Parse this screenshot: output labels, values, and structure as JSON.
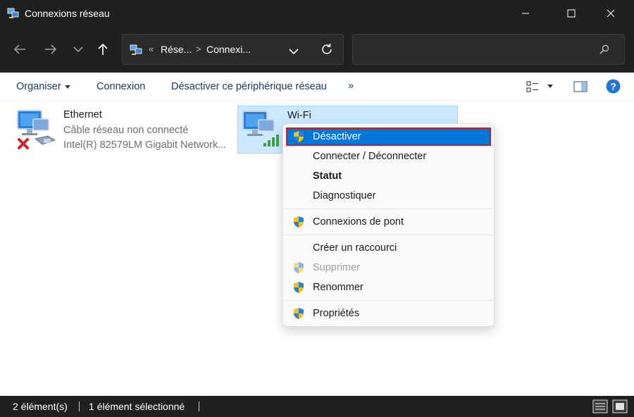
{
  "window": {
    "title": "Connexions réseau",
    "controls": {
      "minimize": "minimize-icon",
      "maximize": "maximize-icon",
      "close": "close-icon"
    }
  },
  "address": {
    "overflow": "«",
    "parts": [
      "Rése...",
      "Connexi..."
    ],
    "separator": ">",
    "search_placeholder": ""
  },
  "toolbar": {
    "organize": "Organiser",
    "connect": "Connexion",
    "disable_device": "Désactiver ce périphérique réseau",
    "more": "»"
  },
  "items": [
    {
      "name": "Ethernet",
      "status": "Câble réseau non connecté",
      "device": "Intel(R) 82579LM Gigabit Network..."
    },
    {
      "name": "Wi-Fi"
    }
  ],
  "context_menu": {
    "items": [
      {
        "label": "Désactiver",
        "shield": true,
        "selected": true
      },
      {
        "label": "Connecter / Déconnecter"
      },
      {
        "label": "Statut",
        "bold": true
      },
      {
        "label": "Diagnostiquer"
      },
      {
        "label": "Connexions de pont",
        "shield": true
      },
      {
        "label": "Créer un raccourci"
      },
      {
        "label": "Supprimer",
        "shield": true,
        "disabled": true
      },
      {
        "label": "Renommer",
        "shield": true
      },
      {
        "label": "Propriétés",
        "shield": true
      }
    ]
  },
  "status": {
    "count": "2 élément(s)",
    "selected": "1 élément sélectionné"
  },
  "colors": {
    "accent": "#0078d7",
    "selection_border": "#d1181e",
    "dark_chrome": "#202020",
    "item_highlight": "#cce8ff"
  }
}
